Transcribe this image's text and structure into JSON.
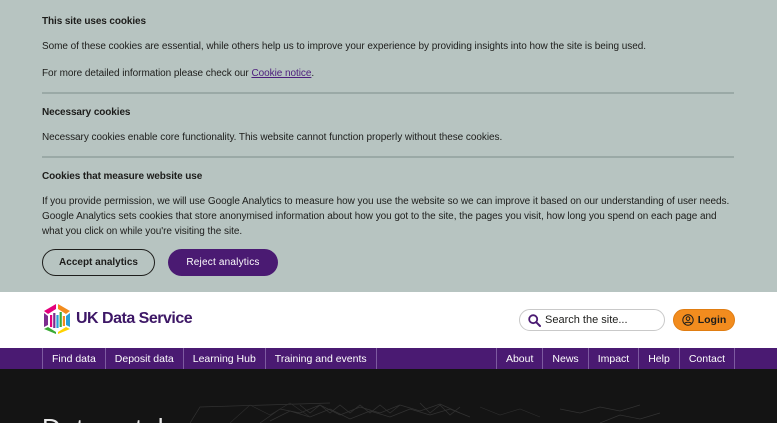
{
  "cookie_banner": {
    "heading_main": "This site uses cookies",
    "intro": "Some of these cookies are essential, while others help us to improve your experience by providing insights into how the site is being used.",
    "more_info_prefix": "For more detailed information please check our ",
    "more_info_link": "Cookie notice",
    "more_info_suffix": ".",
    "necessary_heading": "Necessary cookies",
    "necessary_text": "Necessary cookies enable core functionality. This website cannot function properly without these cookies.",
    "analytics_heading": "Cookies that measure website use",
    "analytics_text": "If you provide permission, we will use Google Analytics to measure how you use the website so we can improve it based on our understanding of user needs. Google Analytics sets cookies that store anonymised information about how you got to the site, the pages you visit, how long you spend on each page and what you click on while you're visiting the site.",
    "accept_label": "Accept analytics",
    "reject_label": "Reject analytics"
  },
  "header": {
    "logo_text": "UK Data Service",
    "search_placeholder": "Search the site...",
    "login_label": "Login"
  },
  "nav": {
    "left": [
      "Find data",
      "Deposit data",
      "Learning Hub",
      "Training and events"
    ],
    "right": [
      "About",
      "News",
      "Impact",
      "Help",
      "Contact"
    ]
  },
  "hero": {
    "title": "Data catalogue"
  },
  "colors": {
    "banner_bg": "#b7c4c1",
    "brand_purple": "#4a1a72",
    "login_orange": "#f28c1e",
    "hero_bg": "#141414"
  },
  "icons": {
    "search": "search-icon",
    "login": "user-icon",
    "logo": "ukds-logo-mark"
  }
}
